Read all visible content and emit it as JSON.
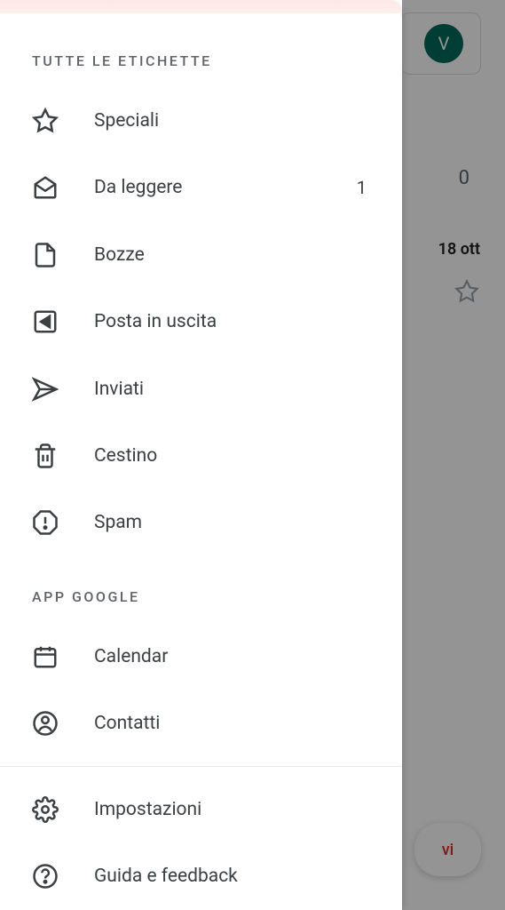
{
  "background": {
    "avatar_letter": "V",
    "zero": "0",
    "date": "18 ott",
    "fab_text": "vi"
  },
  "drawer": {
    "section_labels": "TUTTE LE ETICHETTE",
    "labels": {
      "starred": "Speciali",
      "unread": {
        "label": "Da leggere",
        "count": "1"
      },
      "drafts": "Bozze",
      "outbox": "Posta in uscita",
      "sent": "Inviati",
      "trash": "Cestino",
      "spam": "Spam"
    },
    "section_google": "APP GOOGLE",
    "google": {
      "calendar": "Calendar",
      "contacts": "Contatti"
    },
    "footer": {
      "settings": "Impostazioni",
      "help": "Guida e feedback"
    }
  }
}
